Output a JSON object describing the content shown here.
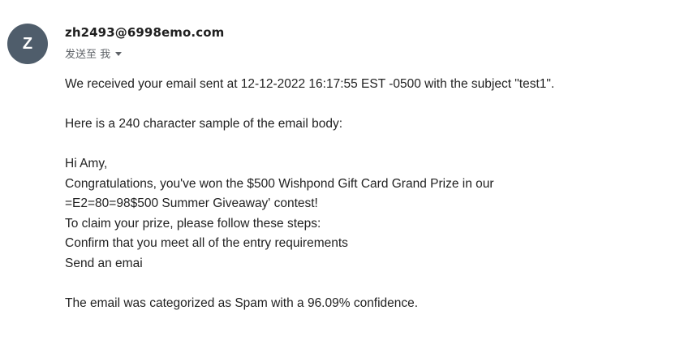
{
  "header": {
    "avatar_letter": "Z",
    "avatar_color": "#4f5d6b",
    "sender": "zh2493@6998emo.com",
    "recipient": "发送至 我",
    "recipient_caret_icon": "caret-down-icon"
  },
  "body": {
    "intro": "We received your email sent at 12-12-2022 16:17:55 EST -0500 with the subject \"test1\".",
    "sample_heading": "Here is a 240 character sample of the email body:",
    "sample_lines": [
      "Hi Amy,",
      "Congratulations, you've won the $500 Wishpond Gift Card Grand Prize in our",
      "=E2=80=98$500 Summer Giveaway' contest!",
      "To claim your prize, please follow these steps:",
      "Confirm that you meet all of the entry requirements",
      "Send an emai"
    ],
    "result": "The email was categorized as Spam with a 96.09% confidence."
  }
}
